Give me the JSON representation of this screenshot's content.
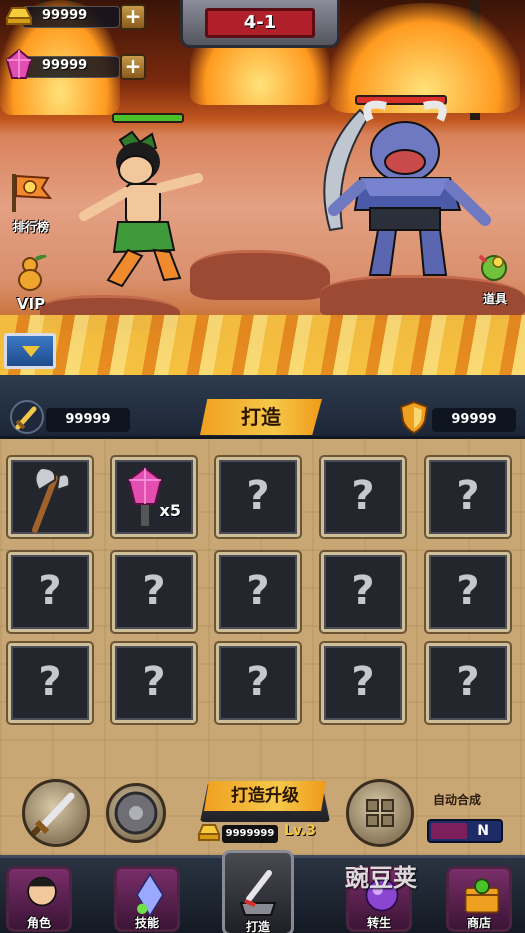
{
  "resources": {
    "gold": {
      "value": "99999",
      "plus": "+",
      "icon": "gold-ingot-icon"
    },
    "gems": {
      "value": "99999",
      "plus": "+",
      "icon": "pink-gem-icon"
    }
  },
  "stage": {
    "label": "4-1"
  },
  "side_buttons": {
    "ranking": {
      "label": "排行榜",
      "icon": "ranking-flag-icon"
    },
    "vip": {
      "label": "VIP",
      "icon": "gourd-icon"
    },
    "props": {
      "label": "道具",
      "icon": "prop-icon"
    }
  },
  "battle": {
    "hero_hp_fraction": 1.0,
    "enemy_hp_fraction": 1.0,
    "hero": "calabash-hero",
    "enemy": "blue-ox-demon"
  },
  "forge_panel": {
    "title": "打造",
    "attack": {
      "value": "99999",
      "icon": "sword-icon"
    },
    "defense": {
      "value": "99999",
      "icon": "shield-icon"
    },
    "slots": [
      {
        "kind": "axe",
        "qty": ""
      },
      {
        "kind": "gem",
        "qty": "x5"
      },
      {
        "kind": "locked",
        "qty": ""
      },
      {
        "kind": "locked",
        "qty": ""
      },
      {
        "kind": "locked",
        "qty": ""
      },
      {
        "kind": "locked",
        "qty": ""
      },
      {
        "kind": "locked",
        "qty": ""
      },
      {
        "kind": "locked",
        "qty": ""
      },
      {
        "kind": "locked",
        "qty": ""
      },
      {
        "kind": "locked",
        "qty": ""
      },
      {
        "kind": "locked",
        "qty": ""
      },
      {
        "kind": "locked",
        "qty": ""
      },
      {
        "kind": "locked",
        "qty": ""
      },
      {
        "kind": "locked",
        "qty": ""
      },
      {
        "kind": "locked",
        "qty": ""
      }
    ],
    "locked_mark": "?",
    "upgrade": {
      "label": "打造升级",
      "cost": "9999999",
      "level": "Lv.3"
    },
    "auto_merge": {
      "label": "自动合成",
      "state": "N"
    }
  },
  "bottom_nav": [
    {
      "label": "角色",
      "icon": "character-portrait-icon"
    },
    {
      "label": "技能",
      "icon": "skill-crystal-icon"
    },
    {
      "label": "打造",
      "icon": "forge-anvil-icon"
    },
    {
      "label": "转生",
      "icon": "rebirth-orb-icon"
    },
    {
      "label": "商店",
      "icon": "shop-chest-icon"
    }
  ],
  "watermark": "豌豆荚"
}
